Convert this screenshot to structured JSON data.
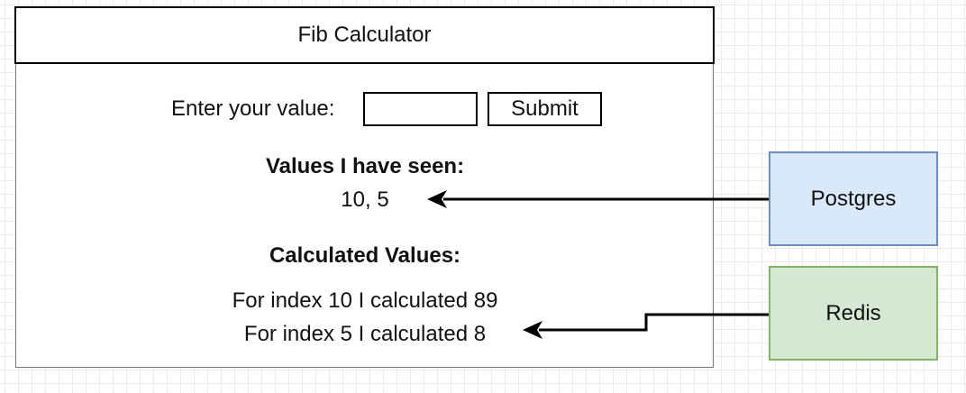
{
  "app": {
    "title": "Fib Calculator",
    "input_label": "Enter your value:",
    "input_value": "",
    "submit_label": "Submit"
  },
  "seen": {
    "heading": "Values I have seen:",
    "values": "10, 5"
  },
  "calculated": {
    "heading": "Calculated Values:",
    "lines": [
      "For index 10 I calculated 89",
      "For index 5 I calculated 8"
    ]
  },
  "stores": {
    "postgres": "Postgres",
    "redis": "Redis"
  },
  "colors": {
    "postgres_fill": "#dae8fc",
    "postgres_stroke": "#6c8ebf",
    "redis_fill": "#d5e8d4",
    "redis_stroke": "#82b366"
  }
}
